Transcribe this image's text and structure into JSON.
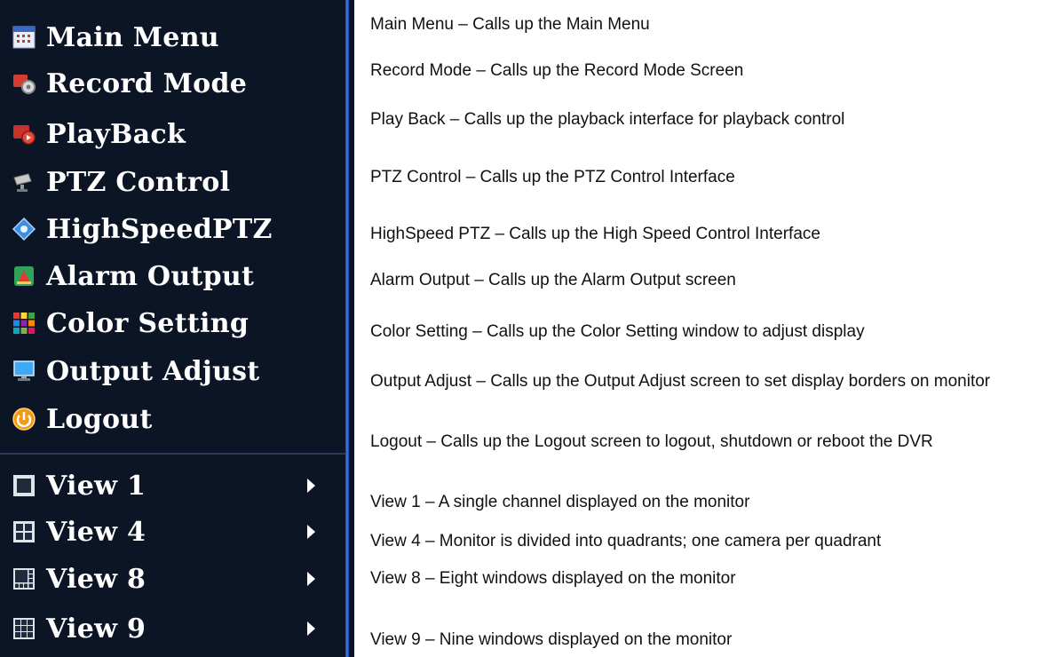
{
  "menu": {
    "items": [
      {
        "label": "Main Menu",
        "icon": "grid-app-icon"
      },
      {
        "label": "Record Mode",
        "icon": "record-gear-icon"
      },
      {
        "label": "PlayBack",
        "icon": "playback-icon"
      },
      {
        "label": "PTZ Control",
        "icon": "ptz-camera-icon"
      },
      {
        "label": "HighSpeedPTZ",
        "icon": "highspeed-ptz-icon"
      },
      {
        "label": "Alarm Output",
        "icon": "alarm-icon"
      },
      {
        "label": "Color Setting",
        "icon": "color-grid-icon"
      },
      {
        "label": "Output Adjust",
        "icon": "monitor-icon"
      },
      {
        "label": "Logout",
        "icon": "power-icon"
      }
    ],
    "views": [
      {
        "label": "View 1",
        "icon": "single-view-icon",
        "arrow": "submenu-arrow-icon"
      },
      {
        "label": "View 4",
        "icon": "quad-view-icon",
        "arrow": "submenu-arrow-icon"
      },
      {
        "label": "View 8",
        "icon": "eight-view-icon",
        "arrow": "submenu-arrow-icon"
      },
      {
        "label": "View 9",
        "icon": "nine-view-icon",
        "arrow": "submenu-arrow-icon"
      }
    ]
  },
  "descriptions": [
    "Main Menu – Calls up the Main Menu",
    "Record Mode – Calls up the Record Mode Screen",
    "Play Back – Calls up the playback interface for playback control",
    "PTZ Control – Calls up the PTZ Control Interface",
    "HighSpeed PTZ – Calls up the High Speed Control Interface",
    "Alarm Output – Calls up the Alarm Output screen",
    "Color Setting – Calls up the Color Setting window to adjust display",
    "Output Adjust – Calls up the Output Adjust screen to set display borders on monitor",
    "Logout – Calls up the Logout screen to logout, shutdown or reboot the DVR",
    "View 1 – A single channel displayed on the monitor",
    "View 4 – Monitor is divided into quadrants; one camera per quadrant",
    "View 8 – Eight windows displayed on the monitor",
    "View 9 – Nine windows displayed on the monitor"
  ],
  "colors": {
    "panel_bg": "#0c1526",
    "panel_border": "#3f7be0",
    "menu_text": "#ffffff",
    "desc_text": "#111111"
  }
}
